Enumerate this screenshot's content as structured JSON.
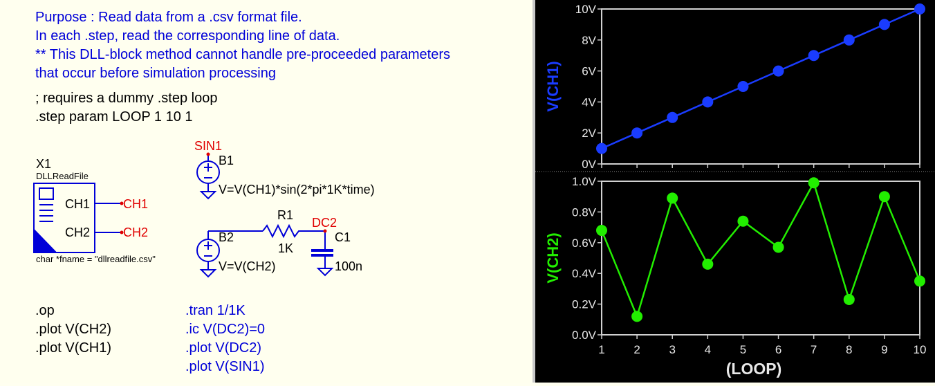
{
  "comments": {
    "purpose_lines": [
      "Purpose : Read data from a .csv format file.",
      "In each .step, read the corresponding line of data.",
      "** This DLL-block method cannot handle pre-proceeded parameters",
      "that occur before simulation processing"
    ],
    "step_lines": [
      "; requires a dummy .step loop",
      ".step param LOOP 1 10 1"
    ]
  },
  "dll_block": {
    "ref": "X1",
    "name": "DLLReadFile",
    "pin1": "CH1",
    "pin2": "CH2",
    "net1": "CH1",
    "net2": "CH2",
    "param": "char *fname = \"dllreadfile.csv\""
  },
  "sources": {
    "b1_net": "SIN1",
    "b1_ref": "B1",
    "b1_expr": "V=V(CH1)*sin(2*pi*1K*time)",
    "b2_ref": "B2",
    "b2_expr": "V=V(CH2)",
    "r1_ref": "R1",
    "r1_val": "1K",
    "dc2_net": "DC2",
    "c1_ref": "C1",
    "c1_val": "100n"
  },
  "directives": {
    "black": [
      ".op",
      ".plot V(CH2)",
      ".plot V(CH1)"
    ],
    "blue": [
      ".tran 1/1K",
      ".ic V(DC2)=0",
      ".plot V(DC2)",
      ".plot V(SIN1)"
    ]
  },
  "colors": {
    "ch1": "#1a3cff",
    "ch2": "#22ee00",
    "schematic_blue": "#0000d8",
    "net_red": "#e00000"
  },
  "chart_data": [
    {
      "type": "line",
      "ylabel": "V(CH1)",
      "x": [
        1,
        2,
        3,
        4,
        5,
        6,
        7,
        8,
        9,
        10
      ],
      "series": [
        {
          "values": [
            1,
            2,
            3,
            4,
            5,
            6,
            7,
            8,
            9,
            10
          ]
        }
      ],
      "ylim": [
        0,
        10
      ],
      "xlim": [
        1,
        10
      ],
      "yticks": [
        "0V",
        "2V",
        "4V",
        "6V",
        "8V",
        "10V"
      ],
      "ytick_values": [
        0,
        2,
        4,
        6,
        8,
        10
      ]
    },
    {
      "type": "line",
      "ylabel": "V(CH2)",
      "xlabel": "(LOOP)",
      "x": [
        1,
        2,
        3,
        4,
        5,
        6,
        7,
        8,
        9,
        10
      ],
      "series": [
        {
          "values": [
            0.68,
            0.12,
            0.89,
            0.46,
            0.74,
            0.57,
            0.99,
            0.23,
            0.9,
            0.35
          ]
        }
      ],
      "ylim": [
        0,
        1
      ],
      "xlim": [
        1,
        10
      ],
      "yticks": [
        "0.0V",
        "0.2V",
        "0.4V",
        "0.6V",
        "0.8V",
        "1.0V"
      ],
      "ytick_values": [
        0,
        0.2,
        0.4,
        0.6,
        0.8,
        1.0
      ],
      "xticks": [
        "1",
        "2",
        "3",
        "4",
        "5",
        "6",
        "7",
        "8",
        "9",
        "10"
      ]
    }
  ]
}
